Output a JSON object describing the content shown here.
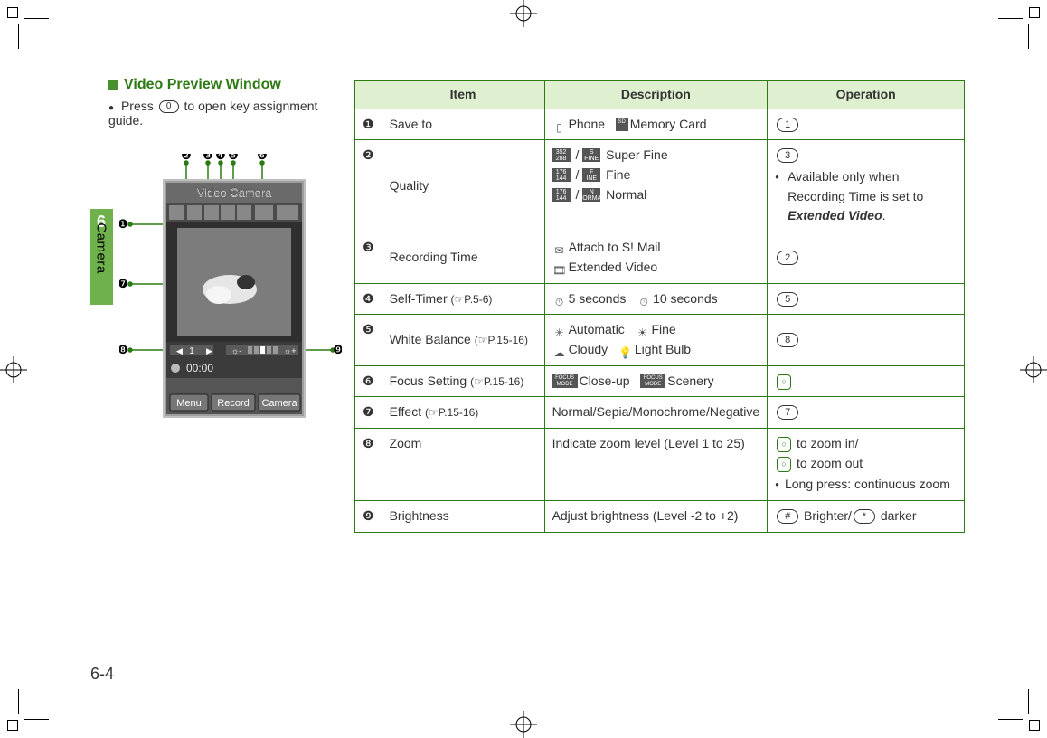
{
  "sidetab": {
    "chapter_num": "6",
    "chapter_label": "Camera"
  },
  "heading": {
    "title": "Video Preview Window",
    "sub_prefix": "Press",
    "sub_key": "0",
    "sub_suffix": "to open key assignment guide."
  },
  "preview": {
    "title_bar": "Video Camera",
    "status_left_label": "1",
    "timer": "00:00",
    "softkey_left": "Menu",
    "softkey_center": "Record",
    "softkey_right": "Camera",
    "callouts": [
      "❶",
      "❷",
      "❸",
      "❹",
      "❺",
      "❻",
      "❼",
      "❽",
      "❾"
    ]
  },
  "page_number": "6-4",
  "table": {
    "headers": {
      "item": "Item",
      "description": "Description",
      "operation": "Operation"
    },
    "rows": [
      {
        "idx": "❶",
        "item": "Save to",
        "desc_parts": [
          {
            "icon": "phone",
            "text": "Phone"
          },
          {
            "icon": "sd",
            "text": "Memory Card"
          }
        ],
        "op_key": "1"
      },
      {
        "idx": "❷",
        "item": "Quality",
        "desc_lines": [
          {
            "left": "352\n288",
            "right": "S\nFINE",
            "text": "Super Fine"
          },
          {
            "left": "176\n144",
            "right": "F\nINE",
            "text": "Fine"
          },
          {
            "left": "176\n144",
            "right": "N\nORMAL",
            "text": "Normal"
          }
        ],
        "op_key": "3",
        "op_note_prefix": "Available only when Recording Time is set to ",
        "op_note_em": "Extended Video",
        "op_note_suffix": "."
      },
      {
        "idx": "❸",
        "item": "Recording Time",
        "desc_lines2": [
          {
            "icon": "mail",
            "text": "Attach to S! Mail"
          },
          {
            "icon": "ext",
            "text": "Extended Video"
          }
        ],
        "op_key": "2"
      },
      {
        "idx": "❹",
        "item_base": "Self-Timer",
        "item_ref": "P.5-6",
        "desc_parts": [
          {
            "icon": "t5",
            "text": "5 seconds"
          },
          {
            "icon": "t10",
            "text": "10 seconds"
          }
        ],
        "op_key": "5"
      },
      {
        "idx": "❺",
        "item_base": "White Balance",
        "item_ref": "P.15-16",
        "desc_lines2": [
          {
            "pairs": [
              {
                "icon": "auto",
                "text": "Automatic"
              },
              {
                "icon": "fine",
                "text": "Fine"
              }
            ]
          },
          {
            "pairs": [
              {
                "icon": "cloud",
                "text": "Cloudy"
              },
              {
                "icon": "bulb",
                "text": "Light Bulb"
              }
            ]
          }
        ],
        "op_key": "8"
      },
      {
        "idx": "❻",
        "item_base": "Focus Setting",
        "item_ref": "P.15-16",
        "desc_parts": [
          {
            "icon": "focus-close",
            "text": "Close-up"
          },
          {
            "icon": "focus-scene",
            "text": "Scenery"
          }
        ],
        "op_key_green": "0"
      },
      {
        "idx": "❼",
        "item_base": "Effect",
        "item_ref": "P.15-16",
        "desc_text": "Normal/Sepia/Monochrome/Negative",
        "op_key": "7"
      },
      {
        "idx": "❽",
        "item": "Zoom",
        "desc_text": "Indicate zoom level (Level 1 to 25)",
        "op_zoom_in": "to zoom in/",
        "op_zoom_out": "to zoom out",
        "op_note": "Long press: continuous zoom"
      },
      {
        "idx": "❾",
        "item": "Brightness",
        "desc_text": "Adjust brightness (Level -2 to +2)",
        "op_brighter_key": "#",
        "op_brighter_lbl": "Brighter/",
        "op_darker_key": "*",
        "op_darker_lbl": "darker"
      }
    ]
  }
}
